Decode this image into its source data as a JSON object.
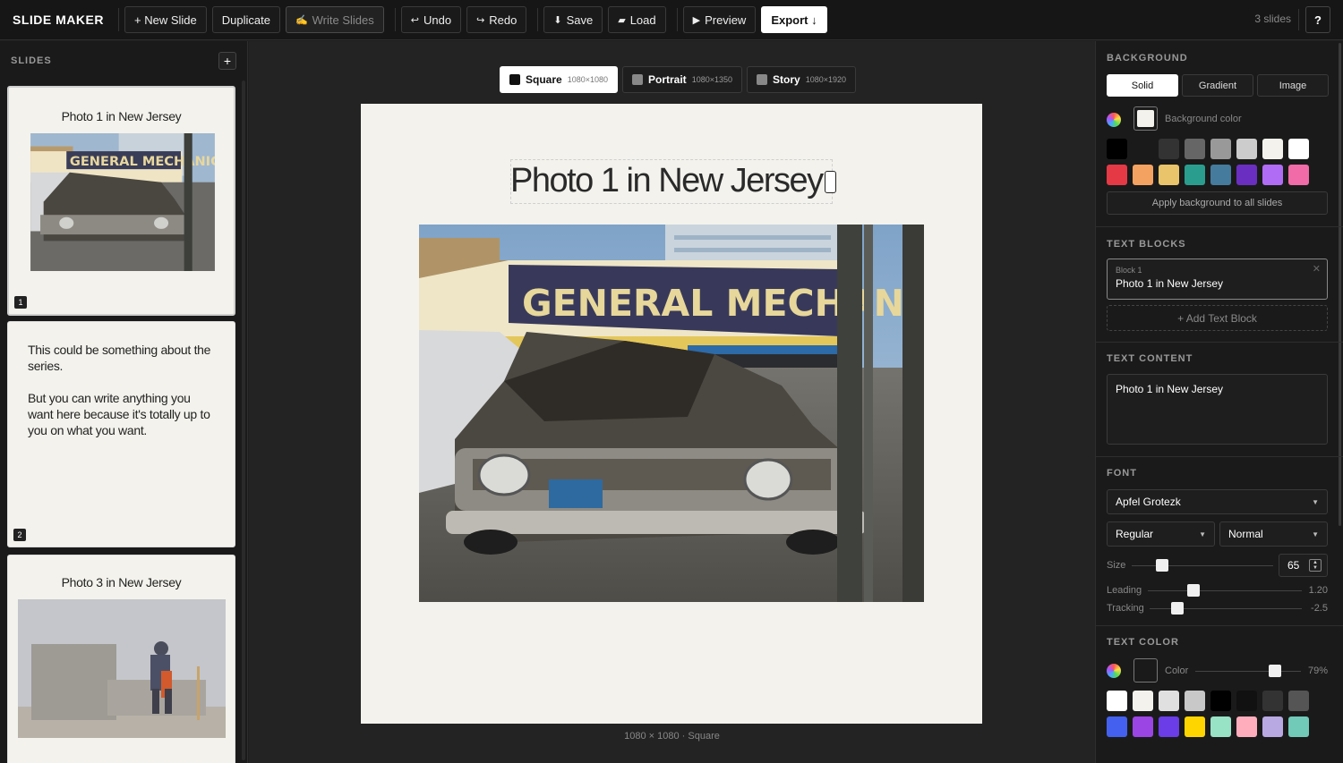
{
  "app": {
    "title": "SLIDE MAKER",
    "slide_count": "3 slides",
    "help": "?"
  },
  "toolbar": {
    "new_slide": "+ New Slide",
    "duplicate": "Duplicate",
    "write_slides": "Write Slides",
    "undo": "Undo",
    "redo": "Redo",
    "save": "Save",
    "load": "Load",
    "preview": "Preview",
    "export": "Export ↓"
  },
  "sidebar": {
    "title": "SLIDES",
    "add": "+",
    "slides": [
      {
        "num": "1",
        "title": "Photo 1 in New Jersey"
      },
      {
        "num": "2",
        "para1": "This could be something about the series.",
        "para2": "But you can write anything you want here because it's totally up to you on what you want."
      },
      {
        "num": "3",
        "title": "Photo 3 in New Jersey"
      }
    ]
  },
  "formats": [
    {
      "label": "Square",
      "dims": "1080×1080"
    },
    {
      "label": "Portrait",
      "dims": "1080×1350"
    },
    {
      "label": "Story",
      "dims": "1080×1920"
    }
  ],
  "canvas": {
    "title": "Photo 1 in New Jersey",
    "sign_text": "GENERAL MECHANIC",
    "caption": "1080 × 1080 · Square"
  },
  "panel": {
    "background": {
      "title": "BACKGROUND",
      "tabs": [
        "Solid",
        "Gradient",
        "Image"
      ],
      "color_label": "Background color",
      "color": "#f3f2ec",
      "swatches_row1": [
        "#000000",
        "#1a1a1a",
        "#333333",
        "#666666",
        "#999999",
        "#cccccc",
        "#f3f2ec",
        "#ffffff"
      ],
      "swatches_row2": [
        "#e53946",
        "#f4a261",
        "#e9c46a",
        "#2a9d8f",
        "#457b9d",
        "#6a2fc0",
        "#b16cf5",
        "#f06ba8"
      ],
      "apply_all": "Apply background to all slides"
    },
    "text_blocks": {
      "title": "TEXT BLOCKS",
      "block_label": "Block 1",
      "block_text": "Photo 1 in New Jersey",
      "add": "+ Add Text Block"
    },
    "text_content": {
      "title": "TEXT CONTENT",
      "value": "Photo 1 in New Jersey"
    },
    "font": {
      "title": "FONT",
      "family": "Apfel Grotezk",
      "weight": "Regular",
      "style": "Normal",
      "size_label": "Size",
      "size": "65",
      "leading_label": "Leading",
      "leading": "1.20",
      "tracking_label": "Tracking",
      "tracking": "-2.5"
    },
    "text_color": {
      "title": "TEXT COLOR",
      "color_label": "Color",
      "opacity": "79%",
      "color": "#1a1a1a",
      "swatches_row1": [
        "#ffffff",
        "#f3f2ec",
        "#e0e0e0",
        "#c8c8c8",
        "#000000",
        "#111111",
        "#333333",
        "#555555"
      ],
      "swatches_row2": [
        "#4361ee",
        "#9b45e4",
        "#6a3de8",
        "#ffd500",
        "#98e2c6",
        "#ffadbc",
        "#b8a9e3",
        "#71c9b8"
      ]
    }
  }
}
